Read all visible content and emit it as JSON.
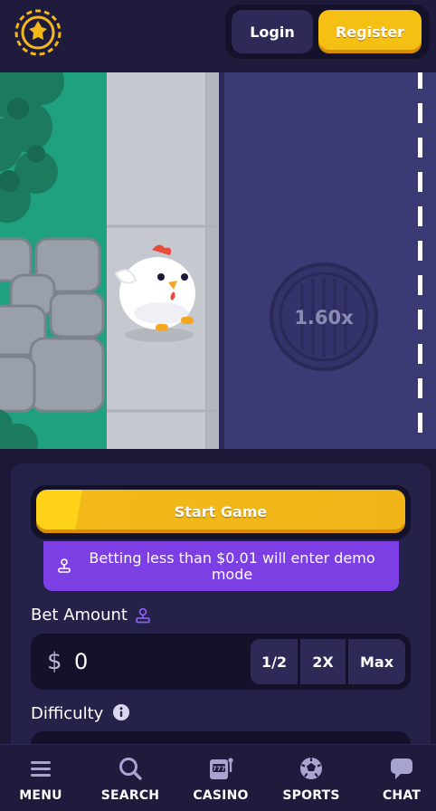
{
  "header": {
    "login_label": "Login",
    "register_label": "Register"
  },
  "game": {
    "multiplier": "1.60x"
  },
  "bet_panel": {
    "start_label": "Start Game",
    "demo_notice": "Betting less than $0.01 will enter demo mode",
    "bet_amount_label": "Bet Amount",
    "currency_symbol": "$",
    "bet_value": "0",
    "half_label": "1/2",
    "double_label": "2X",
    "max_label": "Max",
    "difficulty_label": "Difficulty"
  },
  "bottom_nav": {
    "items": [
      {
        "label": "MENU",
        "icon": "menu-icon"
      },
      {
        "label": "SEARCH",
        "icon": "search-icon"
      },
      {
        "label": "CASINO",
        "icon": "slot-machine-icon"
      },
      {
        "label": "SPORTS",
        "icon": "soccer-ball-icon"
      },
      {
        "label": "CHAT",
        "icon": "chat-bubble-icon"
      }
    ]
  },
  "colors": {
    "background": "#1b1838",
    "accent_yellow": "#f5c013",
    "accent_purple": "#7b3fe4",
    "road": "#3c3a74",
    "grass": "#1fa07e",
    "sidewalk": "#c6c8cf"
  }
}
